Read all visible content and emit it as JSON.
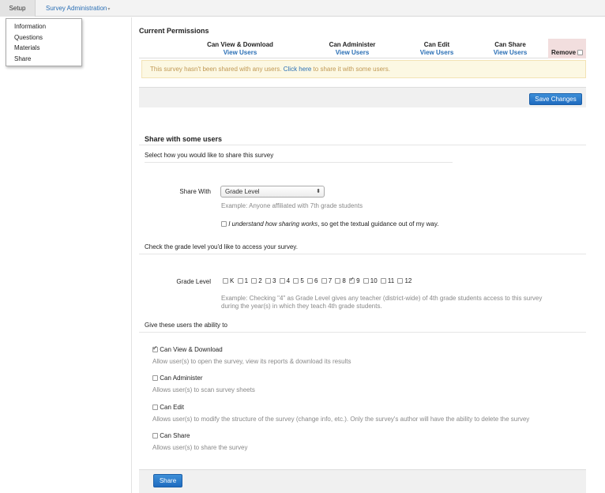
{
  "topbar": {
    "setup_label": "Setup",
    "survey_admin_label": "Survey Administration",
    "caret": "▾"
  },
  "dropdown": {
    "items": [
      "Information",
      "Questions",
      "Materials",
      "Share"
    ]
  },
  "permissions": {
    "title": "Current Permissions",
    "columns": [
      {
        "header": "Can View & Download",
        "link": "View Users"
      },
      {
        "header": "Can Administer",
        "link": "View Users"
      },
      {
        "header": "Can Edit",
        "link": "View Users"
      },
      {
        "header": "Can Share",
        "link": "View Users"
      }
    ],
    "remove_label": "Remove",
    "notice_text": "This survey hasn't been shared with any users.",
    "notice_link": "Click here",
    "notice_suffix": "to share it with some users.",
    "save_label": "Save Changes"
  },
  "share": {
    "title": "Share with some users",
    "select_prompt": "Select how you would like to share this survey",
    "share_with_label": "Share With",
    "share_with_value": "Grade Level",
    "share_with_example": "Example: Anyone affiliated with 7th grade students",
    "understand_italic": "I understand how sharing works",
    "understand_rest": ", so get the textual guidance out of my way.",
    "grade_prompt": "Check the grade level you'd like to access your survey.",
    "grade_label": "Grade Level",
    "grades": [
      {
        "label": "K",
        "checked": false
      },
      {
        "label": "1",
        "checked": false
      },
      {
        "label": "2",
        "checked": false
      },
      {
        "label": "3",
        "checked": false
      },
      {
        "label": "4",
        "checked": false
      },
      {
        "label": "5",
        "checked": false
      },
      {
        "label": "6",
        "checked": false
      },
      {
        "label": "7",
        "checked": false
      },
      {
        "label": "8",
        "checked": false
      },
      {
        "label": "9",
        "checked": true
      },
      {
        "label": "10",
        "checked": false
      },
      {
        "label": "11",
        "checked": false
      },
      {
        "label": "12",
        "checked": false
      }
    ],
    "grade_example_1": "Example: Checking \"4\" as Grade Level gives any teacher (district-wide) of 4th grade students access to this survey",
    "grade_example_2": "during the year(s) in which they teach 4th grade students.",
    "ability_prompt": "Give these users the ability to",
    "abilities": [
      {
        "title": "Can View & Download",
        "desc": "Allow user(s) to open the survey, view its reports & download its results",
        "checked": true
      },
      {
        "title": "Can Administer",
        "desc": "Allows user(s) to scan survey sheets",
        "checked": false
      },
      {
        "title": "Can Edit",
        "desc": "Allows user(s) to modify the structure of the survey (change info, etc.). Only the survey's author will have the ability to delete the survey",
        "checked": false
      },
      {
        "title": "Can Share",
        "desc": "Allows user(s) to share the survey",
        "checked": false
      }
    ],
    "share_button": "Share"
  }
}
